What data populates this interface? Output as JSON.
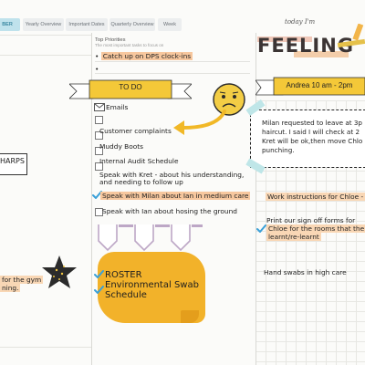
{
  "tabs": [
    {
      "label": "BER",
      "active": true
    },
    {
      "label": "Yearly Overview",
      "active": false
    },
    {
      "label": "Important Dates",
      "active": false
    },
    {
      "label": "Quarterly Overview",
      "active": false
    },
    {
      "label": "Week",
      "active": false
    }
  ],
  "priorities": {
    "title": "Top Priorities",
    "subtitle": "The most important tasks to focus on",
    "items": [
      "Catch up on DPS clock-ins",
      ""
    ]
  },
  "header_art": {
    "today_text": "today I'm",
    "feeling_text": "FEELING"
  },
  "todo": {
    "banner": "TO DO",
    "items": [
      {
        "text": "Emails",
        "checked": false
      },
      {
        "text": "Customer complaints",
        "checked": false
      },
      {
        "text": "Muddy Boots",
        "checked": false
      },
      {
        "text": "Internal Audit Schedule",
        "checked": false
      },
      {
        "text": "Speak with Kret - about his understanding,",
        "text2": "and needing to follow up",
        "checked": false
      },
      {
        "text": "Speak with Milan about Ian in medium care",
        "checked": true
      },
      {
        "text": "Speak with Ian about hosing the ground",
        "checked": false
      }
    ]
  },
  "roster_note": {
    "lines": [
      "ROSTER",
      "Environmental Swab",
      "Schedule"
    ]
  },
  "right_panel": {
    "banner": "Andrea 10 am - 2pm",
    "note_lines": [
      "Milan requested to leave at 3p",
      "haircut. I said I will check at 2",
      "Kret will be ok,then move Chlo",
      "punching."
    ],
    "work_instructions": "Work instructions for Chloe -",
    "print_lines": [
      "Print our sign off forms for",
      "Chloe for the rooms that the",
      "learnt/re-learnt"
    ],
    "hand_swabs": "Hand swabs in high care"
  },
  "left_panel": {
    "sharps_label": "HARPS",
    "gym_lines": [
      "for the gym",
      "ning."
    ]
  },
  "colors": {
    "tab_active_bg": "#bfe2ec",
    "banner_yellow": "#f4c838",
    "highlight_orange": "#f7c79e",
    "roster_yellow": "#f2b22a",
    "check_blue": "#3aa0d8"
  }
}
